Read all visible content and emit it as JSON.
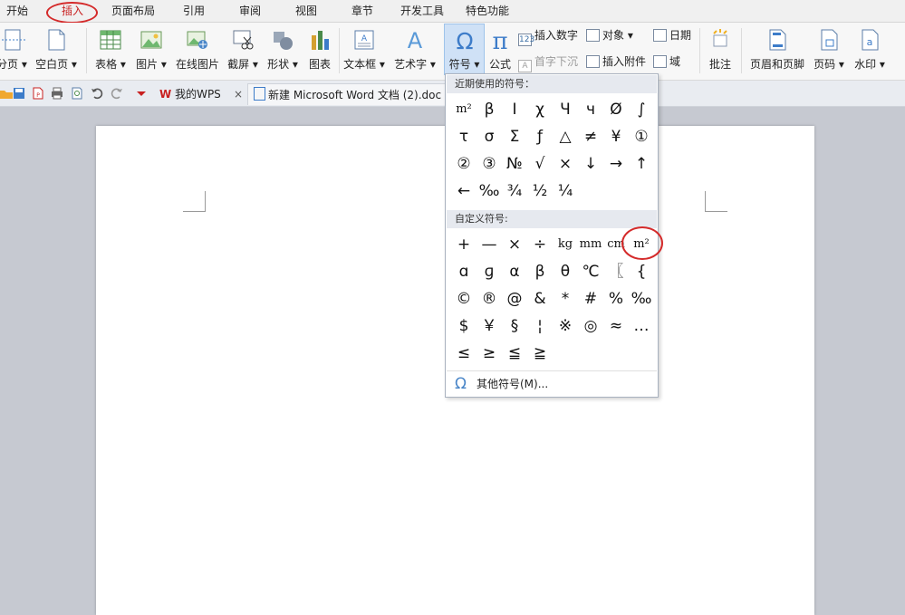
{
  "menu": {
    "tabs": [
      {
        "label": "开始"
      },
      {
        "label": "插入"
      },
      {
        "label": "页面布局"
      },
      {
        "label": "引用"
      },
      {
        "label": "审阅"
      },
      {
        "label": "视图"
      },
      {
        "label": "章节"
      },
      {
        "label": "开发工具"
      },
      {
        "label": "特色功能"
      }
    ],
    "active_tab": "插入"
  },
  "ribbon": {
    "buttons": [
      {
        "label": "分页 ▾"
      },
      {
        "label": "空白页 ▾"
      },
      {
        "label": "表格 ▾"
      },
      {
        "label": "图片 ▾"
      },
      {
        "label": "在线图片"
      },
      {
        "label": "截屏 ▾"
      },
      {
        "label": "形状 ▾"
      },
      {
        "label": "图表"
      },
      {
        "label": "文本框 ▾"
      },
      {
        "label": "艺术字 ▾"
      },
      {
        "label": "符号 ▾"
      },
      {
        "label": "公式"
      },
      {
        "label": "批注"
      },
      {
        "label": "页眉和页脚"
      },
      {
        "label": "页码 ▾"
      },
      {
        "label": "水印 ▾"
      }
    ],
    "small_buttons": {
      "insert_number": "插入数字",
      "object": "对象 ▾",
      "date": "日期",
      "drop_cap": "首字下沉",
      "insert_attachment": "插入附件",
      "field": "域"
    }
  },
  "quickbar": {
    "doc_tabs": [
      {
        "label": "我的WPS"
      },
      {
        "label": "新建 Microsoft Word 文档 (2).doc"
      }
    ],
    "close_symbol": "×"
  },
  "symbol_dropdown": {
    "recent_header": "近期使用的符号：",
    "recent_symbols": [
      "m²",
      "β",
      "Ⅰ",
      "χ",
      "Ч",
      "ч",
      "Ø",
      "∫",
      "τ",
      "σ",
      "Σ",
      "ƒ",
      "△",
      "≠",
      "¥",
      "①",
      "②",
      "③",
      "№",
      "√",
      "×",
      "↓",
      "→",
      "↑",
      "←",
      "‰",
      "¾",
      "½",
      "¼"
    ],
    "custom_header": "自定义符号:",
    "custom_symbols": [
      "+",
      "—",
      "×",
      "÷",
      "kg",
      "mm",
      "cm",
      "m²",
      "ɑ",
      "ɡ",
      "α",
      "β",
      "θ",
      "℃",
      "〖",
      "{",
      "©",
      "®",
      "@",
      "&",
      "*",
      "#",
      "%",
      "‰",
      "$",
      "￥",
      "§",
      "¦",
      "※",
      "◎",
      "≈",
      "…",
      "≤",
      "≥",
      "≦",
      "≧"
    ],
    "more_symbols": "其他符号(M)...",
    "more_icon": "Ω"
  },
  "colors": {
    "accent_red": "#d42a2a",
    "selection_blue": "#cfe1f6",
    "canvas_gray": "#c6c9d1"
  }
}
